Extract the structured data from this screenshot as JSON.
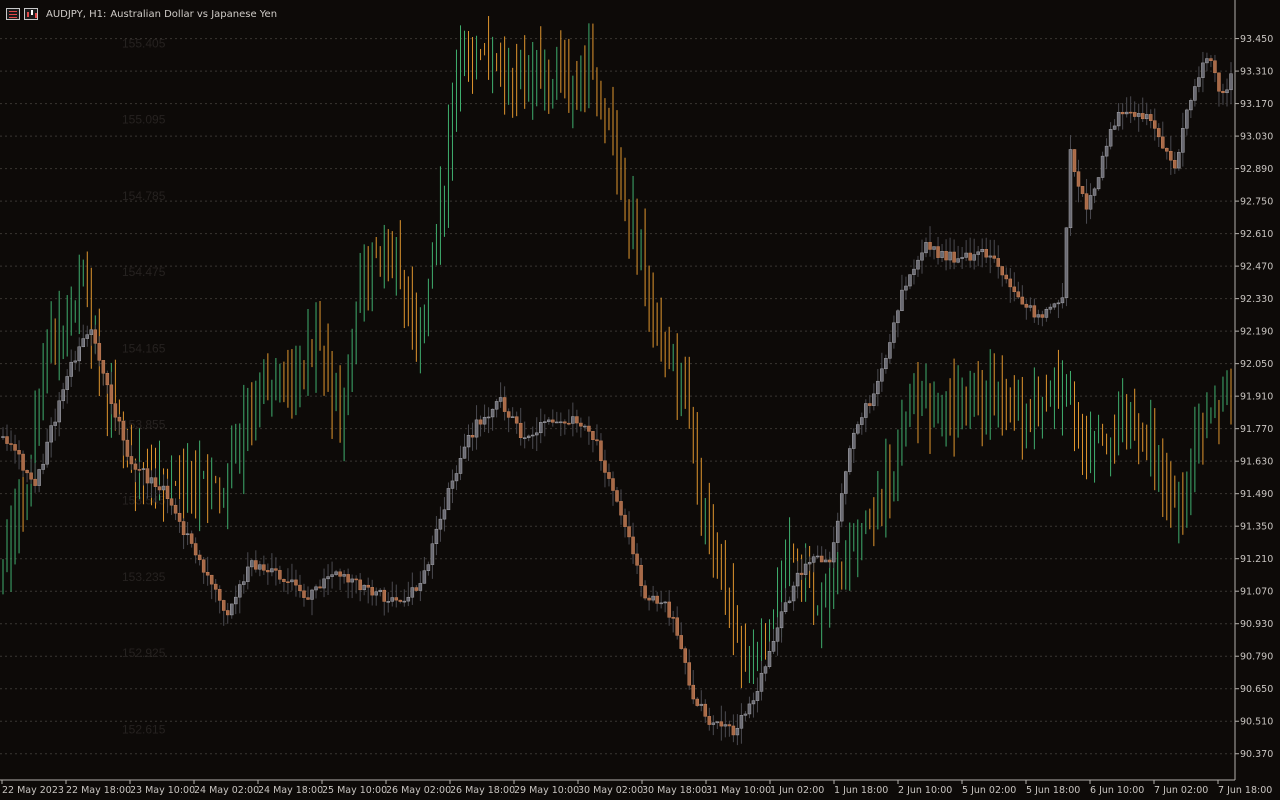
{
  "title_bar": {
    "symbol_timeframe": "AUDJPY, H1:",
    "description": "Australian Dollar vs Japanese Yen"
  },
  "colors": {
    "background": "#0d0a08",
    "axis_text": "#c8c4c0",
    "grid": "#3a3632",
    "candle_up": "#a6a6ac",
    "candle_down": "#c8825a",
    "overlay_up": "#3fae6e",
    "overlay_down": "#e0962e",
    "secondary_scale_text": "#262220"
  },
  "icons": [
    "list-icon",
    "bar-chart-icon"
  ],
  "chart_data": {
    "type": "candlestick",
    "symbol": "AUDJPY",
    "timeframe": "H1",
    "x_labels": [
      "22 May 2023",
      "22 May 18:00",
      "23 May 10:00",
      "24 May 02:00",
      "24 May 18:00",
      "25 May 10:00",
      "26 May 02:00",
      "26 May 18:00",
      "29 May 10:00",
      "30 May 02:00",
      "30 May 18:00",
      "31 May 10:00",
      "1 Jun 02:00",
      "1 Jun 18:00",
      "2 Jun 10:00",
      "5 Jun 02:00",
      "5 Jun 18:00",
      "6 Jun 10:00",
      "7 Jun 02:00",
      "7 Jun 18:00"
    ],
    "y_ticks": [
      "93.450",
      "93.310",
      "93.170",
      "93.030",
      "92.890",
      "92.750",
      "92.610",
      "92.470",
      "92.330",
      "92.190",
      "92.050",
      "91.910",
      "91.770",
      "91.630",
      "91.490",
      "91.350",
      "91.210",
      "91.070",
      "90.930",
      "90.790",
      "90.650",
      "90.510",
      "90.370"
    ],
    "ylim": [
      90.3,
      93.53
    ],
    "overlay_ticks": [
      "155.405",
      "155.095",
      "154.785",
      "154.475",
      "154.165",
      "153.855",
      "153.545",
      "153.235",
      "152.925",
      "152.615"
    ],
    "overlay_ylim": [
      152.45,
      155.5
    ],
    "grid": true,
    "series": [
      {
        "name": "AUDJPY",
        "anchors": [
          [
            0,
            91.76
          ],
          [
            8,
            91.52
          ],
          [
            16,
            92.0
          ],
          [
            22,
            92.2
          ],
          [
            26,
            91.95
          ],
          [
            32,
            91.62
          ],
          [
            40,
            91.5
          ],
          [
            50,
            91.16
          ],
          [
            56,
            90.97
          ],
          [
            62,
            91.19
          ],
          [
            70,
            91.13
          ],
          [
            76,
            91.04
          ],
          [
            82,
            91.14
          ],
          [
            90,
            91.09
          ],
          [
            98,
            91.02
          ],
          [
            104,
            91.09
          ],
          [
            112,
            91.55
          ],
          [
            118,
            91.8
          ],
          [
            124,
            91.88
          ],
          [
            130,
            91.72
          ],
          [
            136,
            91.8
          ],
          [
            144,
            91.8
          ],
          [
            148,
            91.7
          ],
          [
            152,
            91.5
          ],
          [
            156,
            91.3
          ],
          [
            160,
            91.05
          ],
          [
            164,
            91.04
          ],
          [
            168,
            90.9
          ],
          [
            172,
            90.62
          ],
          [
            176,
            90.52
          ],
          [
            182,
            90.47
          ],
          [
            188,
            90.65
          ],
          [
            194,
            90.97
          ],
          [
            200,
            91.2
          ],
          [
            206,
            91.2
          ],
          [
            212,
            91.76
          ],
          [
            218,
            91.95
          ],
          [
            224,
            92.35
          ],
          [
            230,
            92.55
          ],
          [
            238,
            92.5
          ],
          [
            246,
            92.53
          ],
          [
            252,
            92.35
          ],
          [
            258,
            92.25
          ],
          [
            264,
            92.35
          ],
          [
            266,
            92.95
          ],
          [
            270,
            92.7
          ],
          [
            278,
            93.15
          ],
          [
            286,
            93.1
          ],
          [
            292,
            92.9
          ],
          [
            296,
            93.2
          ],
          [
            300,
            93.38
          ],
          [
            304,
            93.2
          ],
          [
            306,
            93.3
          ]
        ]
      },
      {
        "name": "overlay",
        "anchors": [
          [
            0,
            153.3
          ],
          [
            6,
            153.6
          ],
          [
            10,
            154.1
          ],
          [
            16,
            154.3
          ],
          [
            20,
            154.4
          ],
          [
            24,
            154.1
          ],
          [
            32,
            153.7
          ],
          [
            40,
            153.6
          ],
          [
            48,
            153.6
          ],
          [
            56,
            153.6
          ],
          [
            64,
            154.0
          ],
          [
            72,
            154.0
          ],
          [
            78,
            154.2
          ],
          [
            84,
            153.9
          ],
          [
            90,
            154.5
          ],
          [
            98,
            154.5
          ],
          [
            104,
            154.2
          ],
          [
            110,
            154.8
          ],
          [
            114,
            155.4
          ],
          [
            120,
            155.35
          ],
          [
            126,
            155.2
          ],
          [
            134,
            155.3
          ],
          [
            140,
            155.25
          ],
          [
            146,
            155.3
          ],
          [
            152,
            155.0
          ],
          [
            158,
            154.6
          ],
          [
            164,
            154.2
          ],
          [
            170,
            154.0
          ],
          [
            174,
            153.5
          ],
          [
            178,
            153.3
          ],
          [
            184,
            152.9
          ],
          [
            190,
            152.9
          ],
          [
            196,
            153.4
          ],
          [
            202,
            153.1
          ],
          [
            206,
            153.2
          ],
          [
            212,
            153.3
          ],
          [
            218,
            153.5
          ],
          [
            226,
            153.9
          ],
          [
            234,
            153.95
          ],
          [
            240,
            153.9
          ],
          [
            248,
            154.0
          ],
          [
            254,
            153.9
          ],
          [
            260,
            153.95
          ],
          [
            266,
            154.0
          ],
          [
            270,
            153.7
          ],
          [
            278,
            153.85
          ],
          [
            286,
            153.8
          ],
          [
            292,
            153.5
          ],
          [
            300,
            153.9
          ],
          [
            306,
            154.0
          ]
        ]
      }
    ]
  }
}
